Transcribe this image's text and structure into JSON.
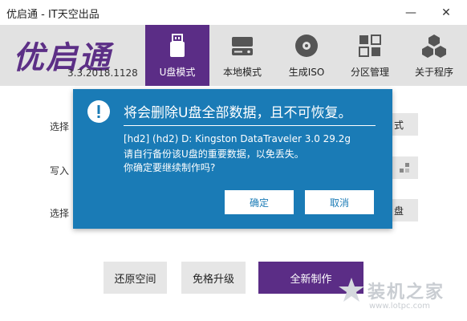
{
  "window": {
    "title": "优启通 - IT天空出品",
    "minimize_glyph": "—",
    "close_glyph": "✕"
  },
  "header": {
    "logo": "优启通",
    "version": "3.3.2018.1128",
    "tabs": [
      {
        "label": "U盘模式",
        "icon": "usb-drive-icon",
        "active": true
      },
      {
        "label": "本地模式",
        "icon": "hard-drive-icon",
        "active": false
      },
      {
        "label": "生成ISO",
        "icon": "disc-icon",
        "active": false
      },
      {
        "label": "分区管理",
        "icon": "grid-icon",
        "active": false
      },
      {
        "label": "关于程序",
        "icon": "cubes-icon",
        "active": false
      }
    ]
  },
  "form": {
    "label_1": "选择",
    "label_2": "写入",
    "label_3": "选择",
    "side_btn_1": "式",
    "side_btn_3": "盘"
  },
  "actions": {
    "restore_label": "还原空间",
    "upgrade_label": "免格升级",
    "new_label": "全新制作"
  },
  "dialog": {
    "heading": "将会删除U盘全部数据，且不可恢复。",
    "device_line": "[hd2] (hd2) D: Kingston DataTraveler 3.0 29.2g",
    "backup_line": "请自行备份该U盘的重要数据，以免丢失。",
    "confirm_line": "你确定要继续制作吗?",
    "ok_label": "确定",
    "cancel_label": "取消"
  },
  "watermark": {
    "text": "装机之家",
    "url": "www.lotpc.com"
  },
  "colors": {
    "brand_purple": "#5b2d86",
    "dialog_blue": "#1a7bb6",
    "header_gray": "#e2e2e2"
  }
}
